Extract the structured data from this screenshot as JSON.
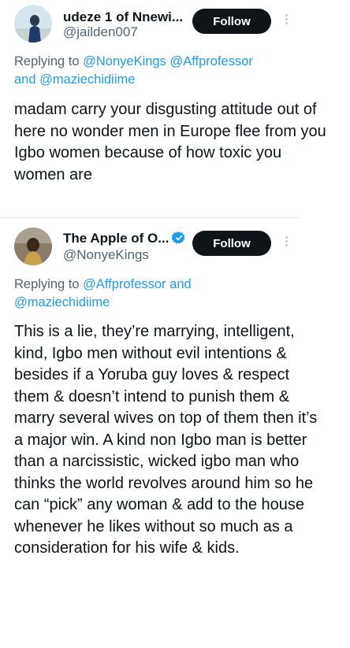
{
  "tweet1": {
    "display_name": "udeze 1 of Nnewi...",
    "handle": "@jailden007",
    "follow_label": "Follow",
    "replying_prefix": "Replying to ",
    "reply_mention_1": "@NonyeKings",
    "reply_mention_2": "@Affprofessor",
    "reply_and": "and",
    "reply_mention_3": "@maziechidiime",
    "text": "madam carry your disgusting attitude out of here no wonder men in Europe flee from you Igbo women because of how toxic you women are"
  },
  "tweet2": {
    "display_name": "The Apple of O...",
    "handle": "@NonyeKings",
    "verified": true,
    "follow_label": "Follow",
    "replying_prefix": "Replying to ",
    "reply_mention_1": "@Affprofessor",
    "reply_and": "and",
    "reply_mention_2": "@maziechidiime",
    "text": "This is a lie, they’re marrying, intelligent, kind, Igbo men without evil intentions & besides if a Yoruba guy loves & respect them & doesn’t intend to punish them & marry several wives on top of them then it’s a major win. A kind non Igbo man is better than a narcissistic, wicked igbo man who thinks the world revolves around him so he can “pick” any woman & add to the house whenever he likes without so much as a consideration for his wife & kids."
  },
  "colors": {
    "text": "#0f1419",
    "secondary": "#536471",
    "link": "#1d9bf0",
    "button_bg": "#0f1419",
    "verified": "#1d9bf0"
  },
  "icons": {
    "more": "more-vertical-icon",
    "verified": "verified-badge-icon"
  }
}
